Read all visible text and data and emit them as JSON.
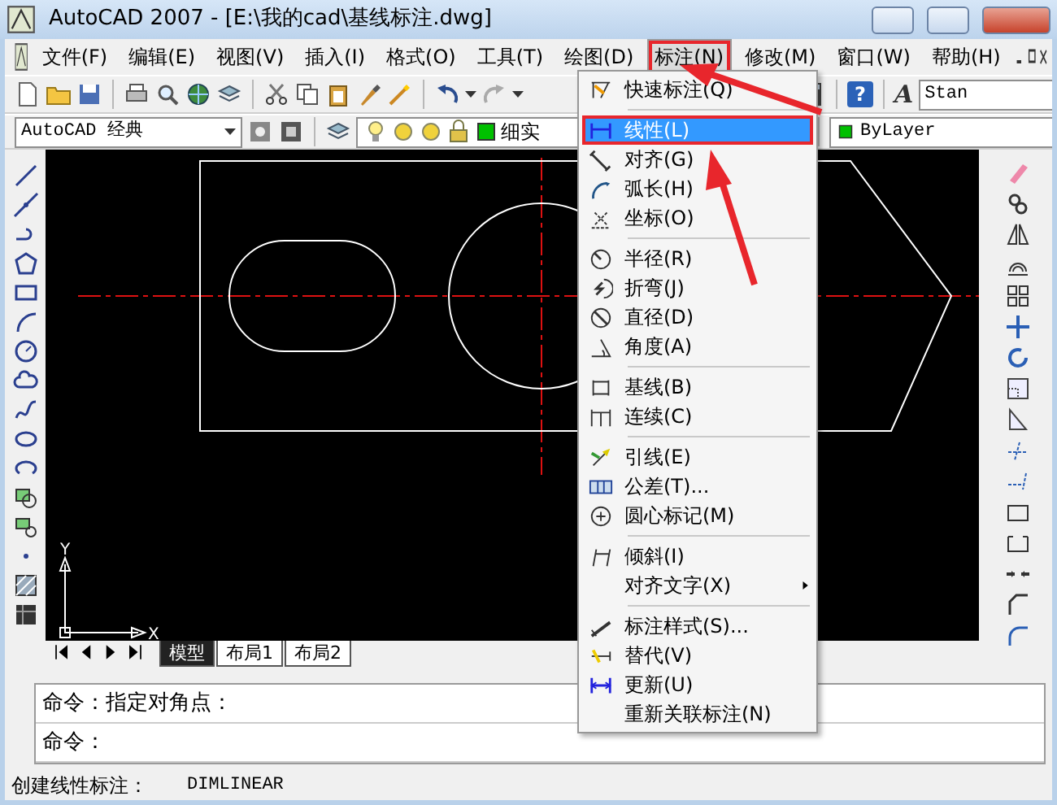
{
  "window": {
    "title": "AutoCAD 2007 - [E:\\我的cad\\基线标注.dwg]"
  },
  "menu_bar": [
    {
      "label": "文件(F)",
      "selected": false,
      "highlighted": false
    },
    {
      "label": "编辑(E)",
      "selected": false,
      "highlighted": false
    },
    {
      "label": "视图(V)",
      "selected": false,
      "highlighted": false
    },
    {
      "label": "插入(I)",
      "selected": false,
      "highlighted": false
    },
    {
      "label": "格式(O)",
      "selected": false,
      "highlighted": false
    },
    {
      "label": "工具(T)",
      "selected": false,
      "highlighted": false
    },
    {
      "label": "绘图(D)",
      "selected": false,
      "highlighted": false
    },
    {
      "label": "标注(N)",
      "selected": true,
      "highlighted": true
    },
    {
      "label": "修改(M)",
      "selected": false,
      "highlighted": false
    },
    {
      "label": "窗口(W)",
      "selected": false,
      "highlighted": false
    },
    {
      "label": "帮助(H)",
      "selected": false,
      "highlighted": false
    }
  ],
  "standard_toolbar": {
    "help_button": "?",
    "text_style_button": "A",
    "text_style": "Stan"
  },
  "layers_toolbar": {
    "workspace": "AutoCAD 经典",
    "layer": "细实",
    "color_setting": "ByLayer"
  },
  "drawing": {
    "ucs_y": "Y",
    "ucs_x": "X"
  },
  "layout_tabs": [
    {
      "label": "模型",
      "selected": true
    },
    {
      "label": "布局1",
      "selected": false
    },
    {
      "label": "布局2",
      "selected": false
    }
  ],
  "command_lines": [
    "命令：指定对角点：",
    "命令："
  ],
  "status_bar": {
    "prompt": "创建线性标注：",
    "command": "DIMLINEAR"
  },
  "dimension_menu": {
    "groups": [
      [
        {
          "label": "快速标注(Q)",
          "selected": false,
          "highlighted": false,
          "submenu": false
        }
      ],
      [
        {
          "label": "线性(L)",
          "selected": true,
          "highlighted": true,
          "submenu": false
        },
        {
          "label": "对齐(G)",
          "selected": false,
          "highlighted": false,
          "submenu": false
        },
        {
          "label": "弧长(H)",
          "selected": false,
          "highlighted": false,
          "submenu": false
        },
        {
          "label": "坐标(O)",
          "selected": false,
          "highlighted": false,
          "submenu": false
        }
      ],
      [
        {
          "label": "半径(R)",
          "selected": false,
          "highlighted": false,
          "submenu": false
        },
        {
          "label": "折弯(J)",
          "selected": false,
          "highlighted": false,
          "submenu": false
        },
        {
          "label": "直径(D)",
          "selected": false,
          "highlighted": false,
          "submenu": false
        },
        {
          "label": "角度(A)",
          "selected": false,
          "highlighted": false,
          "submenu": false
        }
      ],
      [
        {
          "label": "基线(B)",
          "selected": false,
          "highlighted": false,
          "submenu": false
        },
        {
          "label": "连续(C)",
          "selected": false,
          "highlighted": false,
          "submenu": false
        }
      ],
      [
        {
          "label": "引线(E)",
          "selected": false,
          "highlighted": false,
          "submenu": false
        },
        {
          "label": "公差(T)...",
          "selected": false,
          "highlighted": false,
          "submenu": false
        },
        {
          "label": "圆心标记(M)",
          "selected": false,
          "highlighted": false,
          "submenu": false
        }
      ],
      [
        {
          "label": "倾斜(I)",
          "selected": false,
          "highlighted": false,
          "submenu": false
        },
        {
          "label": "对齐文字(X)",
          "selected": false,
          "highlighted": false,
          "submenu": true
        }
      ],
      [
        {
          "label": "标注样式(S)...",
          "selected": false,
          "highlighted": false,
          "submenu": false
        },
        {
          "label": "替代(V)",
          "selected": false,
          "highlighted": false,
          "submenu": false
        },
        {
          "label": "更新(U)",
          "selected": false,
          "highlighted": false,
          "submenu": false
        },
        {
          "label": "重新关联标注(N)",
          "selected": false,
          "highlighted": false,
          "submenu": false
        }
      ]
    ]
  }
}
